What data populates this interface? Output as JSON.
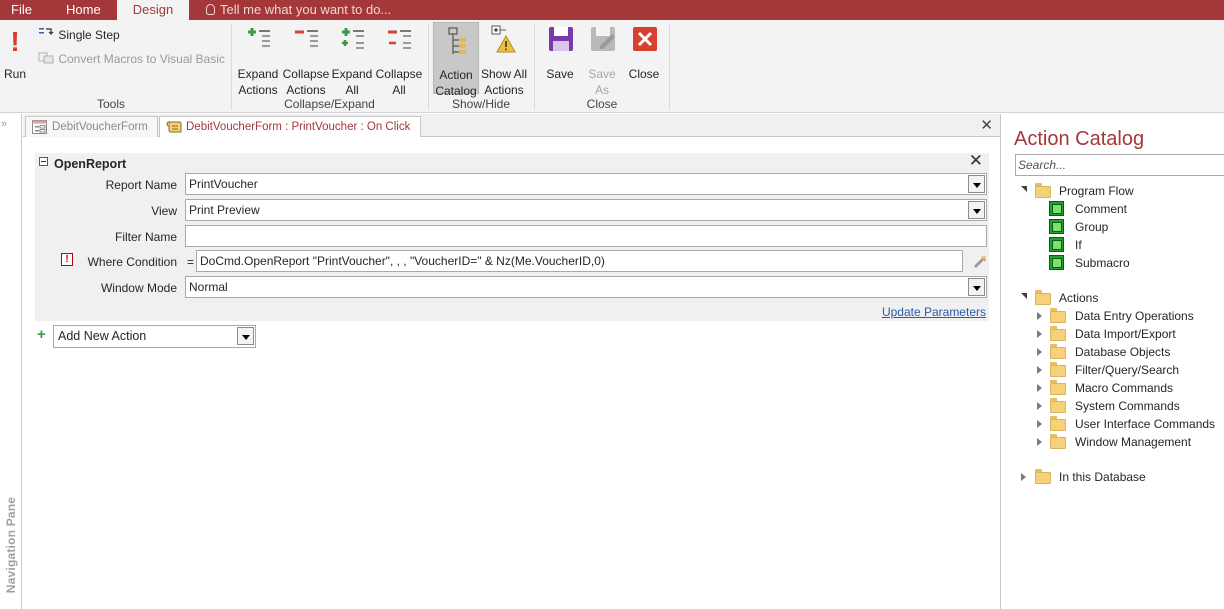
{
  "tabs": {
    "file": "File",
    "home": "Home",
    "design": "Design",
    "tell_me": "Tell me what you want to do..."
  },
  "ribbon": {
    "tools": {
      "label": "Tools",
      "run": "Run",
      "single_step": "Single Step",
      "convert": "Convert Macros to Visual Basic"
    },
    "collapse_expand": {
      "label": "Collapse/Expand",
      "expand_actions": [
        "Expand",
        "Actions"
      ],
      "collapse_actions": [
        "Collapse",
        "Actions"
      ],
      "expand_all": [
        "Expand",
        "All"
      ],
      "collapse_all": [
        "Collapse",
        "All"
      ]
    },
    "show_hide": {
      "label": "Show/Hide",
      "action_catalog": [
        "Action",
        "Catalog"
      ],
      "show_all_actions": [
        "Show All",
        "Actions"
      ]
    },
    "close": {
      "label": "Close",
      "save": "Save",
      "save_as": [
        "Save",
        "As"
      ],
      "close": "Close"
    }
  },
  "nav_pane": {
    "label": "Navigation Pane"
  },
  "doc_tabs": [
    {
      "label": "DebitVoucherForm",
      "active": false
    },
    {
      "label": "DebitVoucherForm : PrintVoucher : On Click",
      "active": true
    }
  ],
  "macro": {
    "action_name": "OpenReport",
    "args": {
      "report_name": {
        "label": "Report Name",
        "value": "PrintVoucher"
      },
      "view": {
        "label": "View",
        "value": "Print Preview"
      },
      "filter_name": {
        "label": "Filter Name",
        "value": ""
      },
      "where_condition": {
        "label": "Where Condition",
        "prefix": "=",
        "value": "DoCmd.OpenReport \"PrintVoucher\", , , \"VoucherID=\" & Nz(Me.VoucherID,0)"
      },
      "window_mode": {
        "label": "Window Mode",
        "value": "Normal"
      }
    },
    "update_parameters": "Update Parameters",
    "add_new_action": "Add New Action"
  },
  "catalog": {
    "title": "Action Catalog",
    "search_placeholder": "Search...",
    "program_flow": {
      "label": "Program Flow",
      "items": [
        "Comment",
        "Group",
        "If",
        "Submacro"
      ]
    },
    "actions": {
      "label": "Actions",
      "items": [
        "Data Entry Operations",
        "Data Import/Export",
        "Database Objects",
        "Filter/Query/Search",
        "Macro Commands",
        "System Commands",
        "User Interface Commands",
        "Window Management"
      ]
    },
    "in_this_database": "In this Database"
  },
  "colors": {
    "accent": "#a4373a",
    "ribbon_bg": "#f3f3f3",
    "link": "#2a5aa8",
    "green_icon": "#20a02c"
  }
}
